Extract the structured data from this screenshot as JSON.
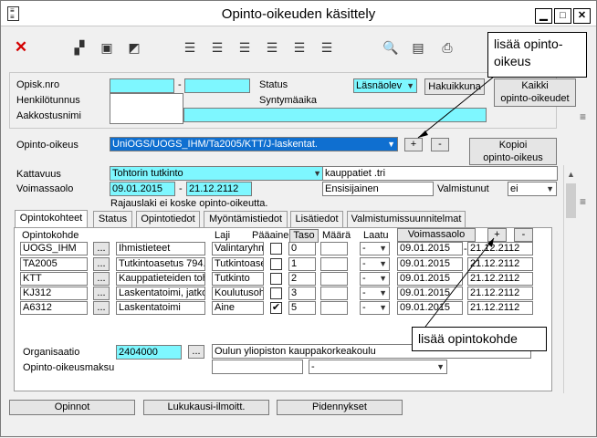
{
  "window": {
    "title": "Opinto-oikeuden käsittely",
    "min": "▁",
    "max": "□",
    "close": "✕"
  },
  "toolbar": {
    "close": "✕"
  },
  "callouts": {
    "add_right": "lisää opinto-\noikeus",
    "add_unit": "lisää opintokohde"
  },
  "student": {
    "opisk_label": "Opisk.nro",
    "opisk_value": "",
    "opisk_value2": "",
    "henk_label": "Henkilötunnus",
    "aakk_label": "Aakkostusnimi",
    "status_label": "Status",
    "status_value": "Läsnäolev",
    "hakuikkuna": "Hakuikkuna",
    "synty_label": "Syntymäaika",
    "kaikki": "Kaikki\nopinto-oikeudet"
  },
  "right": {
    "label": "Opinto-oikeus",
    "value": "UniOGS/UOGS_IHM/Ta2005/KTT/J-laskentat.",
    "plus": "+",
    "minus": "-",
    "kopioi": "Kopioi\nopinto-oikeus",
    "kattavuus_label": "Kattavuus",
    "kattavuus_value": "Tohtorin tutkinto",
    "kattavuus_note": "kauppatiet .tri",
    "voimassa_label": "Voimassaolo",
    "voimassa_from": "09.01.2015",
    "dash": "-",
    "voimassa_to": "21.12.2112",
    "ensisijainen": "Ensisijainen",
    "valmistunut_label": "Valmistunut",
    "valmistunut_value": "ei",
    "rajauslaki": "Rajauslaki ei koske opinto-oikeutta."
  },
  "tabs": [
    "Opintokohteet",
    "Status",
    "Opintotiedot",
    "Myöntämistiedot",
    "Lisätiedot",
    "Valmistumissuunnitelmat"
  ],
  "units": {
    "headers": {
      "kohde": "Opintokohde",
      "laji": "Laji",
      "paaaine": "Pääaine",
      "taso": "Taso",
      "maara": "Määrä",
      "laatu": "Laatu",
      "voimassa": "Voimassaolo"
    },
    "plus": "+",
    "minus": "-",
    "dots": "...",
    "dash": "-",
    "rows": [
      {
        "code": "UOGS_IHM",
        "name": "Ihmistieteet",
        "laji": "Valintaryhm",
        "paa": false,
        "taso": "0",
        "maara": "",
        "laatu": "-",
        "from": "09.01.2015",
        "to": "21.12.2112"
      },
      {
        "code": "TA2005",
        "name": "Tutkintoasetus 794.",
        "laji": "Tutkintoase",
        "paa": false,
        "taso": "1",
        "maara": "",
        "laatu": "-",
        "from": "09.01.2015",
        "to": "21.12.2112"
      },
      {
        "code": "KTT",
        "name": "Kauppatieteiden toh",
        "laji": "Tutkinto",
        "paa": false,
        "taso": "2",
        "maara": "",
        "laatu": "-",
        "from": "09.01.2015",
        "to": "21.12.2112"
      },
      {
        "code": "KJ312",
        "name": "Laskentatoimi, jatko",
        "laji": "Koulutusoh",
        "paa": false,
        "taso": "3",
        "maara": "",
        "laatu": "-",
        "from": "09.01.2015",
        "to": "21.12.2112"
      },
      {
        "code": "A6312",
        "name": "Laskentatoimi",
        "laji": "Aine",
        "paa": true,
        "taso": "5",
        "maara": "",
        "laatu": "-",
        "from": "09.01.2015",
        "to": "21.12.2112"
      }
    ]
  },
  "org": {
    "label": "Organisaatio",
    "code": "2404000",
    "dots": "...",
    "name": "Oulun yliopiston kauppakorkeakoulu",
    "maksu_label": "Opinto-oikeusmaksu",
    "maksu_value": "",
    "maksu_select": "-"
  },
  "bottom": {
    "opinnot": "Opinnot",
    "lukukausi": "Lukukausi-ilmoitt.",
    "pidennykset": "Pidennykset"
  },
  "colors": {
    "cyan": "#7ef7ff",
    "selected": "#0f6fd0",
    "close_red": "#d40000"
  }
}
